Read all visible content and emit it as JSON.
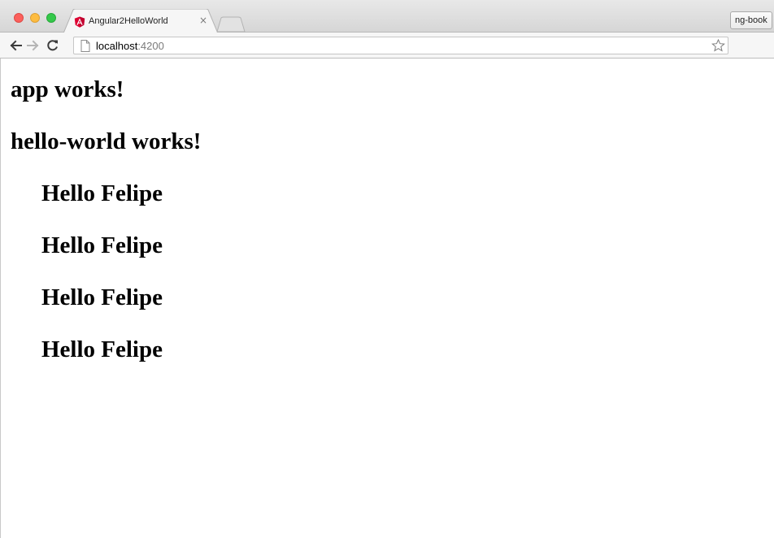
{
  "browser": {
    "tab": {
      "title": "Angular2HelloWorld",
      "close_glyph": "×",
      "favicon": "angular-icon"
    },
    "profile_button": "ng-book",
    "omnibox": {
      "host": "localhost",
      "port": ":4200"
    },
    "icons": {
      "back": "arrow-left-icon",
      "forward": "arrow-right-icon",
      "reload": "reload-icon",
      "page": "page-icon",
      "bookmark": "star-icon",
      "extension": "extension-icon",
      "menu": "hamburger-menu-icon"
    },
    "colors": {
      "traffic_close": "#fc605c",
      "traffic_minimize": "#fdbc40",
      "traffic_maximize": "#34c84a",
      "angular_red": "#dd0031"
    }
  },
  "page": {
    "app_heading": "app works!",
    "hello_world_heading": "hello-world works!",
    "greetings": [
      "Hello Felipe",
      "Hello Felipe",
      "Hello Felipe",
      "Hello Felipe"
    ]
  }
}
